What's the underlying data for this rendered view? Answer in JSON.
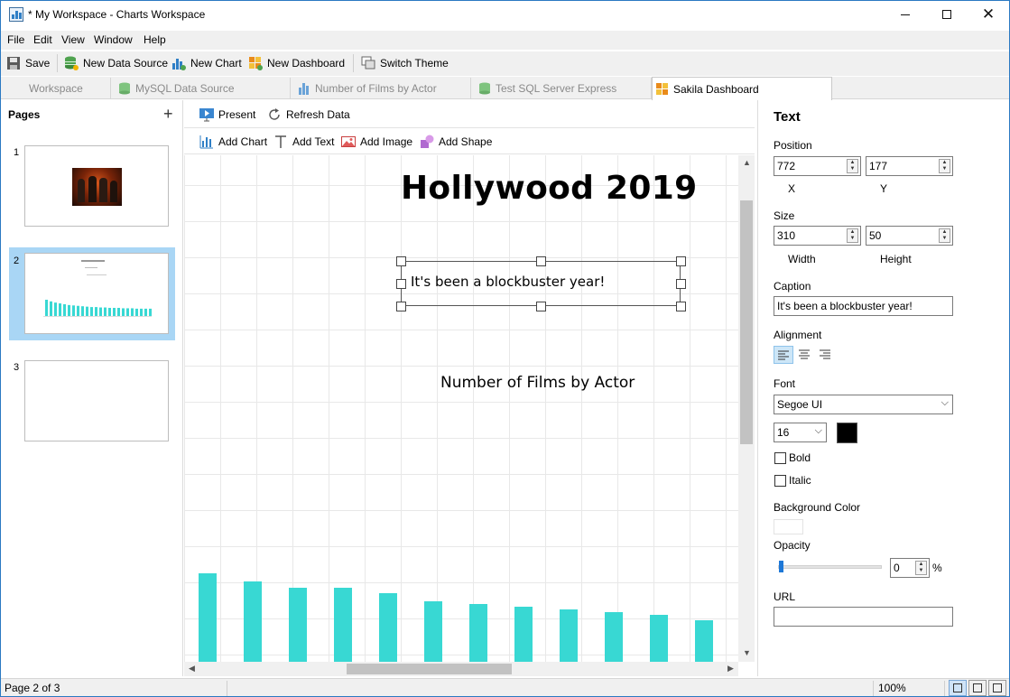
{
  "window": {
    "title": "* My Workspace - Charts Workspace",
    "icons": [
      "app-icon",
      "minimize-icon",
      "maximize-icon",
      "close-icon"
    ]
  },
  "menu": [
    "File",
    "Edit",
    "View",
    "Window",
    "Help"
  ],
  "toolbar": {
    "save": "Save",
    "new_data_source": "New Data Source",
    "new_chart": "New Chart",
    "new_dashboard": "New Dashboard",
    "switch_theme": "Switch Theme"
  },
  "tabs": [
    {
      "label": "Workspace",
      "active": false
    },
    {
      "label": "MySQL Data Source",
      "active": false
    },
    {
      "label": "Number of Films by Actor",
      "active": false
    },
    {
      "label": "Test SQL Server Express",
      "active": false
    },
    {
      "label": "Sakila Dashboard",
      "active": true
    }
  ],
  "pages": {
    "title": "Pages",
    "add_symbol": "+",
    "items": [
      {
        "num": "1"
      },
      {
        "num": "2",
        "selected": true
      },
      {
        "num": "3"
      }
    ]
  },
  "canvas_toolbar": {
    "present": "Present",
    "refresh": "Refresh Data",
    "add_chart": "Add Chart",
    "add_text": "Add Text",
    "add_image": "Add Image",
    "add_shape": "Add Shape"
  },
  "canvas": {
    "heading": "Hollywood 2019",
    "caption": "It's been a blockbuster year!",
    "chart_title": "Number of Films by Actor"
  },
  "chart_data": {
    "type": "bar",
    "title": "Number of Films by Actor",
    "values": [
      98,
      89,
      82,
      82,
      76,
      67,
      64,
      61,
      58,
      55,
      52,
      46
    ],
    "ylim": [
      0,
      100
    ],
    "color": "#38d8d3"
  },
  "properties": {
    "title": "Text",
    "position_label": "Position",
    "x": "772",
    "y": "177",
    "x_label": "X",
    "y_label": "Y",
    "size_label": "Size",
    "width": "310",
    "height": "50",
    "width_label": "Width",
    "height_label": "Height",
    "caption_label": "Caption",
    "caption": "It's been a blockbuster year!",
    "alignment_label": "Alignment",
    "alignment_selected": "left",
    "font_label": "Font",
    "font": "Segoe UI",
    "font_size": "16",
    "font_color": "#000000",
    "bold_label": "Bold",
    "italic_label": "Italic",
    "bold": false,
    "italic": false,
    "bg_color_label": "Background Color",
    "opacity_label": "Opacity",
    "opacity": "0",
    "opacity_unit": "%",
    "url_label": "URL",
    "url": ""
  },
  "status": {
    "page": "Page 2 of 3",
    "zoom": "100%"
  },
  "colors": {
    "accent": "#2b79c2",
    "selected_page": "#a9d6f5",
    "bar": "#38d8d3"
  }
}
